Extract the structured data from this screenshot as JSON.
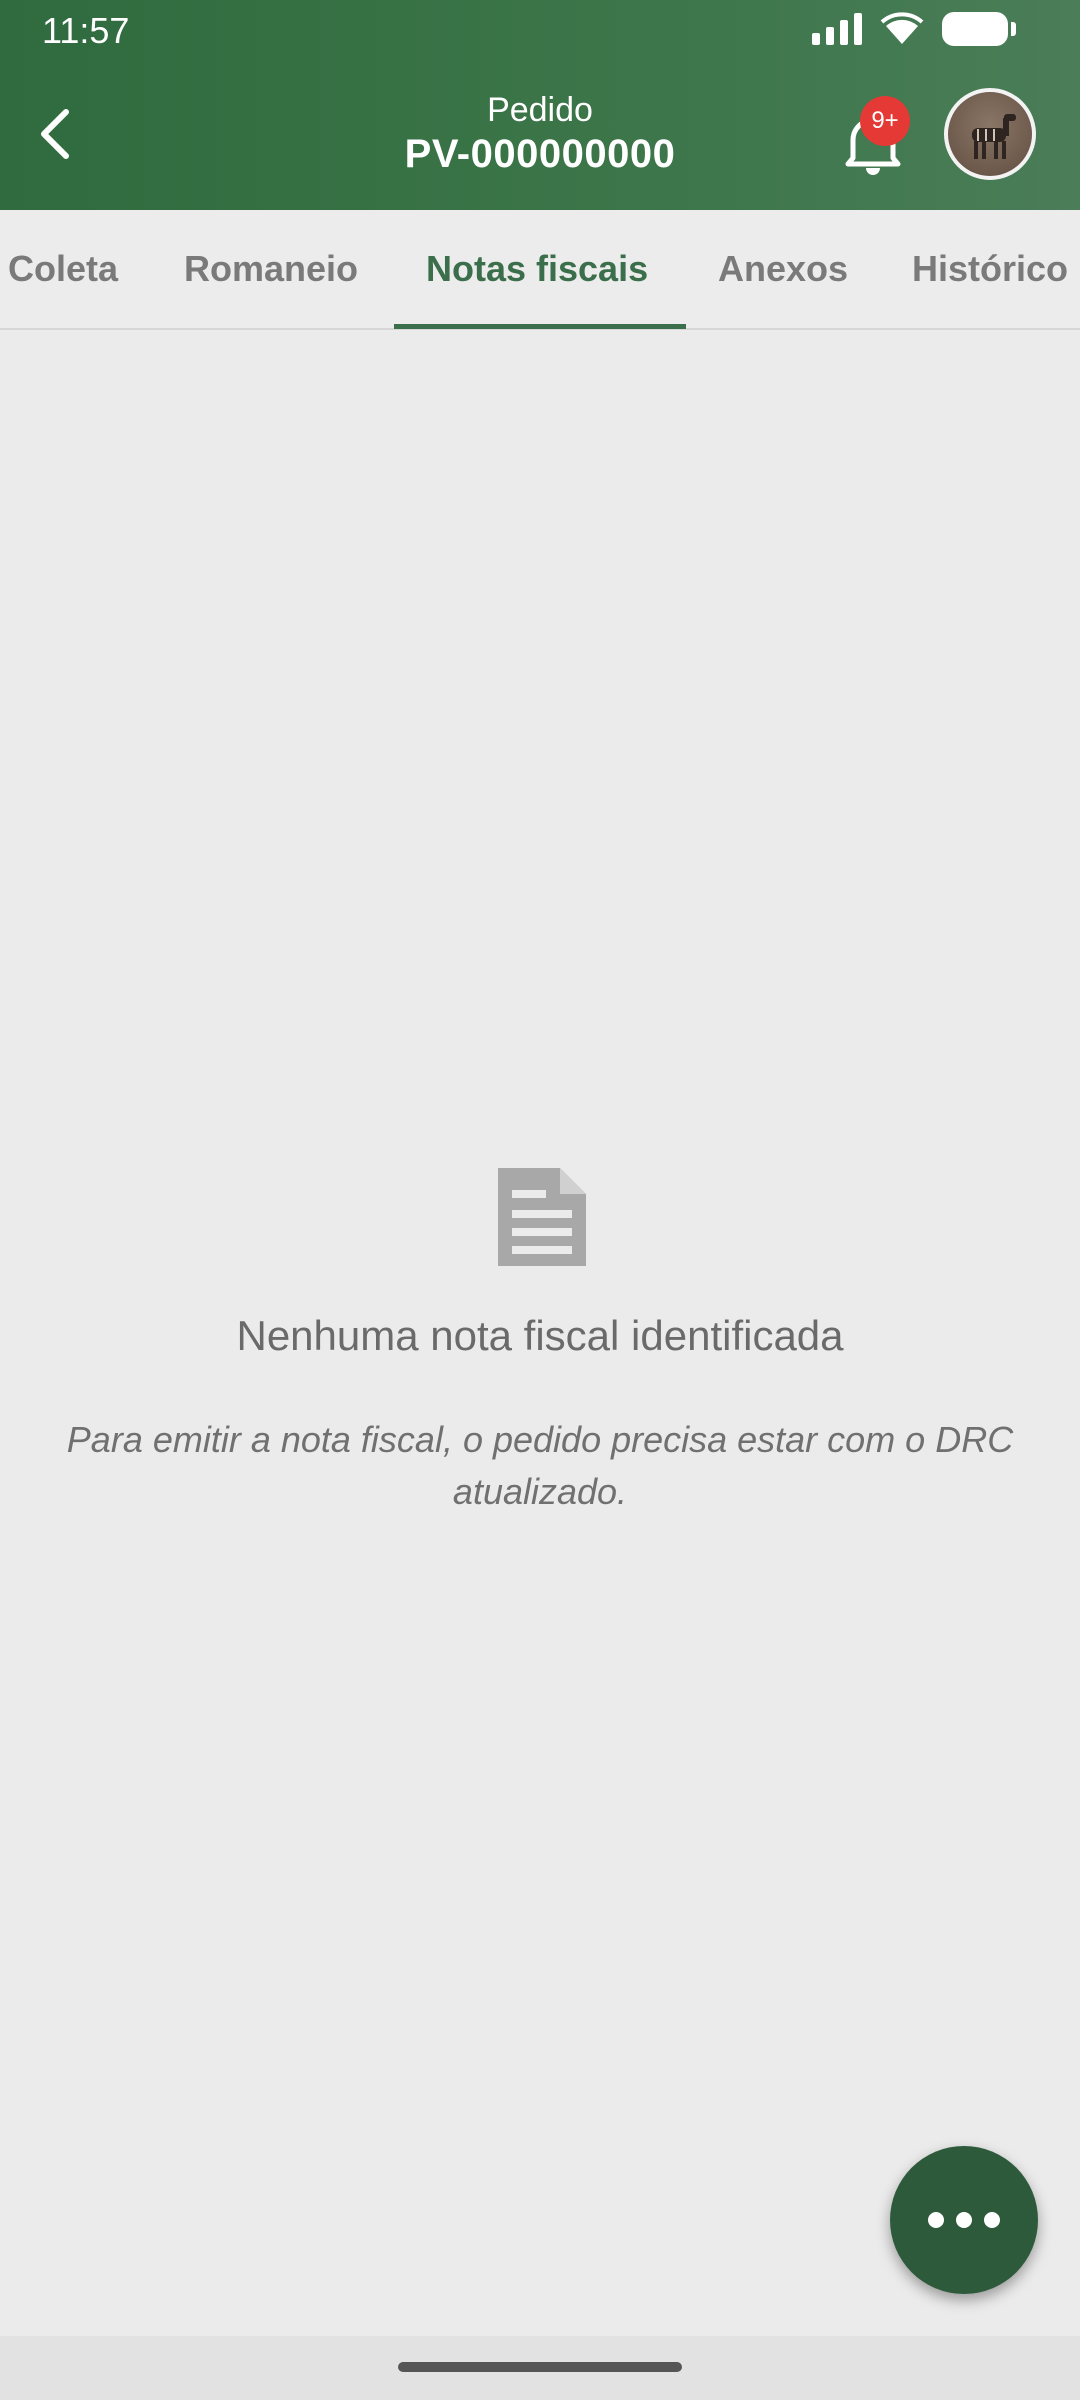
{
  "status_bar": {
    "time": "11:57"
  },
  "header": {
    "title_small": "Pedido",
    "title_big": "PV-000000000",
    "notification_badge": "9+"
  },
  "tabs": [
    {
      "label": "Coleta",
      "active": false
    },
    {
      "label": "Romaneio",
      "active": false
    },
    {
      "label": "Notas fiscais",
      "active": true
    },
    {
      "label": "Anexos",
      "active": false
    },
    {
      "label": "Histórico",
      "active": false
    }
  ],
  "empty_state": {
    "icon": "document-icon",
    "title": "Nenhuma nota fiscal identificada",
    "description": "Para emitir a nota fiscal, o pedido precisa estar com o DRC atualizado."
  },
  "fab": {
    "icon": "more-horizontal-icon"
  },
  "colors": {
    "header_green": "#3b7548",
    "accent_green": "#3b6e4a",
    "fab_green": "#2e5a3c",
    "badge_red": "#e53935"
  }
}
